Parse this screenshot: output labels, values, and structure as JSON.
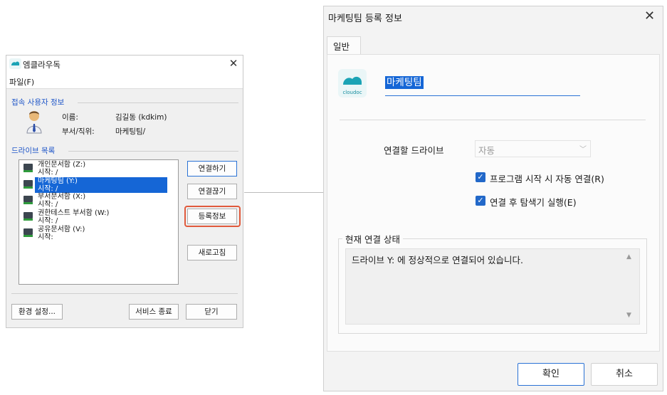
{
  "main_window": {
    "title": "엠클라우독",
    "close_glyph": "✕",
    "menu": [
      "파일(F)"
    ],
    "user_section_title": "접속 사용자 정보",
    "user": {
      "name_label": "이름:",
      "name_value": "김길동 (kdkim)",
      "dept_label": "부서/직위:",
      "dept_value": "마케팅팀/"
    },
    "drive_section_title": "드라이브 목록",
    "drives": [
      {
        "name": "개인문서함 (Z:)",
        "status": "시작: /",
        "selected": false
      },
      {
        "name": "마케팅팀 (Y:)",
        "status": "시작: /",
        "selected": true
      },
      {
        "name": "부서문서함 (X:)",
        "status": "시작: /",
        "selected": false
      },
      {
        "name": "권한테스트 부서함 (W:)",
        "status": "시작: /",
        "selected": false
      },
      {
        "name": "공유문서함 (V:)",
        "status": "시작:",
        "selected": false
      }
    ],
    "buttons": {
      "connect": "연결하기",
      "disconnect": "연결끊기",
      "register_info": "등록정보",
      "refresh": "새로고침",
      "settings": "환경 설정...",
      "stop_service": "서비스 종료",
      "close": "닫기"
    },
    "icons": {
      "drive": "network-drive-icon",
      "user": "user-avatar-icon",
      "app": "cloud-logo-icon"
    }
  },
  "dialog": {
    "title": "마케팅팀 등록 정보",
    "close_glyph": "✕",
    "tab": "일반",
    "logo_text": "cloudoc",
    "drive_name": "마케팅팀",
    "connect_drive_label": "연결할 드라이브",
    "connect_drive_value": "자동",
    "checkbox_autostart": "프로그램 시작 시 자동 연결(R)",
    "checkbox_autostart_checked": true,
    "checkbox_explorer": "연결 후 탐색기 실행(E)",
    "checkbox_explorer_checked": true,
    "status_group_title": "현재 연결 상태",
    "status_text": "드라이브 Y: 에 정상적으로 연결되어 있습니다.",
    "ok": "확인",
    "cancel": "취소"
  },
  "colors": {
    "accent": "#1566d6",
    "highlight_ring": "#e05a3c",
    "section_title": "#1f56c8"
  }
}
